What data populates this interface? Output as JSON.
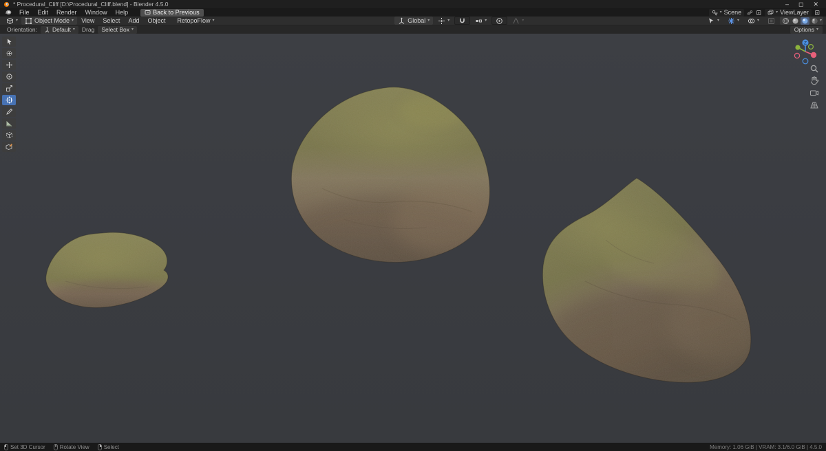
{
  "window": {
    "title": "* Procedural_Cliff [D:\\Procedural_Cliff.blend] - Blender 4.5.0",
    "minimize": "–",
    "maximize": "◻",
    "close": "✕"
  },
  "menubar": {
    "menus": [
      "File",
      "Edit",
      "Render",
      "Window",
      "Help"
    ],
    "back_button": "Back to Previous",
    "scene_label": "Scene",
    "view_layer_label": "ViewLayer"
  },
  "viewport_header": {
    "mode": "Object Mode",
    "menus": [
      "View",
      "Select",
      "Add",
      "Object"
    ],
    "retopoflow": "RetopoFlow",
    "orientation": "Global"
  },
  "tool_settings": {
    "orientation_label": "Orientation:",
    "orientation_value": "Default",
    "drag_label": "Drag",
    "tool_value": "Select Box",
    "options": "Options"
  },
  "toolbar": {
    "tools": [
      "tweak-select",
      "cursor",
      "move",
      "rotate",
      "scale",
      "transform",
      "annotate",
      "measure",
      "add-cube",
      "retopoflow"
    ]
  },
  "scene_objects": [
    {
      "name": "rock-small-left"
    },
    {
      "name": "rock-large-center"
    },
    {
      "name": "rock-large-right"
    }
  ],
  "status_bar": {
    "hint_lmb": "Set 3D Cursor",
    "hint_mmb": "Rotate View",
    "hint_rmb": "Select",
    "stats": "Memory: 1.06 GiB | VRAM: 3.1/6.0 GiB | 4.5.0"
  },
  "colors": {
    "accent": "#4772b3",
    "viewport_bg": "#3b3d42",
    "moss_green": "#7e7c48",
    "rock_brown": "#7d6752",
    "axis_x": "#e8607a",
    "axis_y": "#8db33d",
    "axis_z": "#4a8fe0"
  }
}
